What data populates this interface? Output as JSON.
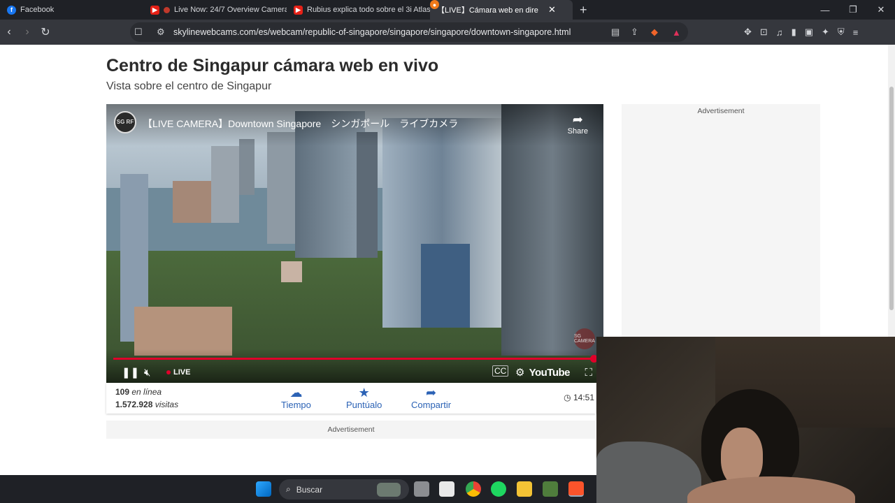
{
  "browser": {
    "tabs": [
      {
        "title": "Facebook",
        "icon": "facebook-icon"
      },
      {
        "title": "Live Now: 24/7 Overview Camera",
        "icon": "youtube-icon"
      },
      {
        "title": "Rubius explica todo sobre el 3i Atlas",
        "icon": "youtube-icon"
      },
      {
        "title": "【LIVE】Cámara web en directo C",
        "icon": "skylinewebcams-icon",
        "active": true
      }
    ],
    "url": "skylinewebcams.com/es/webcam/republic-of-singapore/singapore/singapore/downtown-singapore.html"
  },
  "page": {
    "title": "Centro de Singapur cámara web en vivo",
    "subtitle": "Vista sobre el centro de Singapur",
    "player": {
      "channel_logo": "SG RF",
      "video_title": "【LIVE CAMERA】Downtown Singapore　シンガポール　ライブカメラ",
      "share_label": "Share",
      "live_label": "LIVE",
      "brand_label": "YouTube",
      "watermark": "SG CAMERA",
      "progress_fraction": 1.0
    },
    "stats": {
      "online_count": "109",
      "online_label": "en línea",
      "visits_count": "1.572.928",
      "visits_label": "visitas"
    },
    "actions": [
      {
        "label": "Tiempo",
        "icon": "weather-icon"
      },
      {
        "label": "Puntúalo",
        "icon": "star-icon"
      },
      {
        "label": "Compartir",
        "icon": "share-icon"
      }
    ],
    "clock_time": "14:51",
    "ad_label_bottom": "Advertisement",
    "ad_label_side": "Advertisement"
  },
  "taskbar": {
    "search_label": "Buscar"
  },
  "colors": {
    "accent_blue": "#2b62b5",
    "live_red": "#e0002a",
    "chrome_dark": "#1f2126"
  }
}
